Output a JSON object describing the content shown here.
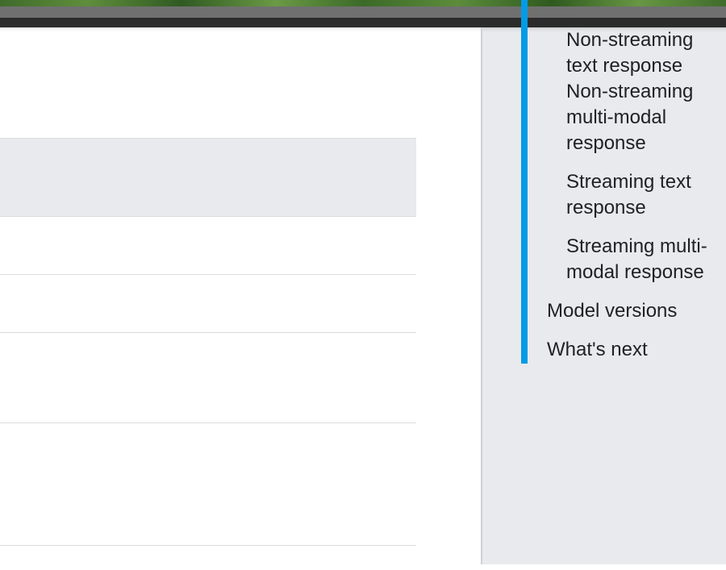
{
  "sidebar": {
    "toc": {
      "sub_items": [
        {
          "label": "Non-streaming text response"
        },
        {
          "label": "Non-streaming multi-modal response"
        },
        {
          "label": "Streaming text response"
        },
        {
          "label": "Streaming multi-modal response"
        }
      ],
      "top_items": [
        {
          "label": "Model versions"
        },
        {
          "label": "What's next"
        }
      ]
    }
  },
  "colors": {
    "toc_active_bar": "#039be5",
    "sidebar_bg": "#e8eaed",
    "table_header_bg": "#e8eaed",
    "text": "#202124"
  }
}
